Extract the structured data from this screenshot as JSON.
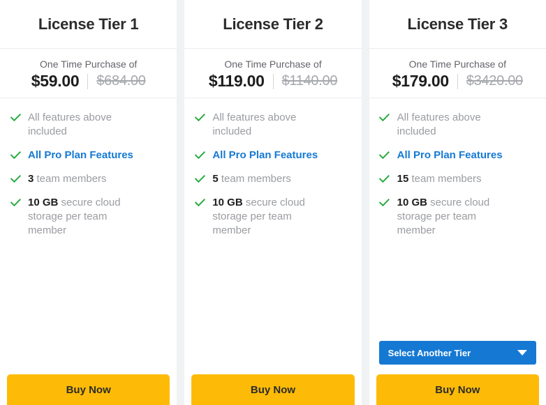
{
  "colors": {
    "accent_blue": "#1579d4",
    "buy_now_yellow": "#fdbb07",
    "check_green": "#21a93b",
    "page_background": "#f1f2f4",
    "card_background": "#ffffff",
    "muted_text": "#9a9ca1",
    "title_text": "#2b2b2b"
  },
  "tiers": [
    {
      "title": "License Tier 1",
      "price_caption": "One Time Purchase of",
      "price_current": "$59.00",
      "price_original": "$684.00",
      "features": [
        {
          "icon": "check-icon",
          "prefix": "",
          "text": "All features above included",
          "style": "muted"
        },
        {
          "icon": "check-icon",
          "prefix": "",
          "text": "All Pro Plan Features",
          "style": "link"
        },
        {
          "icon": "check-icon",
          "prefix": "3",
          "text": " team members",
          "style": "muted"
        },
        {
          "icon": "check-icon",
          "prefix": "10 GB",
          "text": " secure cloud storage per team member",
          "style": "muted"
        }
      ],
      "has_select_tier": false,
      "select_tier_label": "",
      "buy_label": "Buy Now"
    },
    {
      "title": "License Tier 2",
      "price_caption": "One Time Purchase of",
      "price_current": "$119.00",
      "price_original": "$1140.00",
      "features": [
        {
          "icon": "check-icon",
          "prefix": "",
          "text": "All features above included",
          "style": "muted"
        },
        {
          "icon": "check-icon",
          "prefix": "",
          "text": "All Pro Plan Features",
          "style": "link"
        },
        {
          "icon": "check-icon",
          "prefix": "5",
          "text": " team members",
          "style": "muted"
        },
        {
          "icon": "check-icon",
          "prefix": "10 GB",
          "text": " secure cloud storage per team member",
          "style": "muted"
        }
      ],
      "has_select_tier": false,
      "select_tier_label": "",
      "buy_label": "Buy Now"
    },
    {
      "title": "License Tier 3",
      "price_caption": "One Time Purchase of",
      "price_current": "$179.00",
      "price_original": "$3420.00",
      "features": [
        {
          "icon": "check-icon",
          "prefix": "",
          "text": "All features above included",
          "style": "muted"
        },
        {
          "icon": "check-icon",
          "prefix": "",
          "text": "All Pro Plan Features",
          "style": "link"
        },
        {
          "icon": "check-icon",
          "prefix": "15",
          "text": " team members",
          "style": "muted"
        },
        {
          "icon": "check-icon",
          "prefix": "10 GB",
          "text": " secure cloud storage per team member",
          "style": "muted"
        }
      ],
      "has_select_tier": true,
      "select_tier_label": "Select Another Tier",
      "buy_label": "Buy Now"
    }
  ]
}
